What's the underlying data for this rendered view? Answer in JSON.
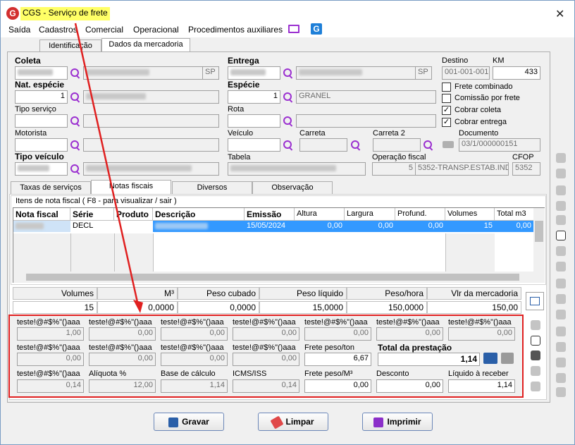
{
  "window": {
    "title": "CGS - Serviço de frete",
    "logo_letter": "G",
    "close_glyph": "✕"
  },
  "menu": {
    "items": [
      "Saída",
      "Cadastros",
      "Comercial",
      "Operacional",
      "Procedimentos auxiliares"
    ],
    "g_icon": "G"
  },
  "tabs_top": {
    "items": [
      "Identificação",
      "Dados da mercadoria"
    ],
    "active": 1
  },
  "form": {
    "coleta": {
      "label": "Coleta",
      "uf": "SP"
    },
    "entrega": {
      "label": "Entrega",
      "uf": "SP"
    },
    "destino": {
      "label": "Destino",
      "value": "001-001-001"
    },
    "km": {
      "label": "KM",
      "value": "433"
    },
    "nat_especie": {
      "label": "Nat. espécie",
      "value": "1"
    },
    "especie": {
      "label": "Espécie",
      "value": "1",
      "desc": "GRANEL"
    },
    "tipo_servico": {
      "label": "Tipo serviço"
    },
    "rota": {
      "label": "Rota"
    },
    "motorista": {
      "label": "Motorista"
    },
    "veiculo": {
      "label": "Veículo"
    },
    "carreta": {
      "label": "Carreta"
    },
    "carreta2": {
      "label": "Carreta 2"
    },
    "documento": {
      "label": "Documento",
      "value": "03/1/000000151"
    },
    "tipo_veiculo": {
      "label": "Tipo veículo"
    },
    "tabela": {
      "label": "Tabela"
    },
    "operacao_fiscal": {
      "label": "Operação fiscal",
      "code": "5",
      "desc": "5352-TRANSP.ESTAB.INDU"
    },
    "cfop": {
      "label": "CFOP",
      "value": "5352"
    },
    "checks": [
      {
        "label": "Frete combinado",
        "checked": false
      },
      {
        "label": "Comissão por frete",
        "checked": false
      },
      {
        "label": "Cobrar coleta",
        "checked": true
      },
      {
        "label": "Cobrar entrega",
        "checked": true
      }
    ]
  },
  "tabs_bottom": {
    "items": [
      "Taxas de serviços",
      "Notas fiscais",
      "Diversos",
      "Observação"
    ],
    "active": 1
  },
  "nf": {
    "group_label": "Itens de nota fiscal ( F8 - para visualizar / sair )",
    "columns": [
      "Nota fiscal",
      "Série",
      "Produto",
      "Descrição",
      "Emissão",
      "Altura",
      "Largura",
      "Profund.",
      "Volumes",
      "Total m3"
    ],
    "row": {
      "serie": "DECL",
      "emissao": "15/05/2024",
      "altura": "0,00",
      "largura": "0,00",
      "profund": "0,00",
      "volumes": "15",
      "total_m3": "0,00"
    }
  },
  "totals": {
    "headers": [
      "Volumes",
      "M³",
      "Peso cubado",
      "Peso líquido",
      "Peso/hora",
      "Vlr da mercadoria"
    ],
    "values": [
      "15",
      "0,0000",
      "0,0000",
      "15,0000",
      "150,0000",
      "150,00"
    ]
  },
  "taxes": {
    "row1": [
      {
        "label": "teste!@#$%\"()aaa",
        "value": "1,00"
      },
      {
        "label": "teste!@#$%\"()aaa",
        "value": "0,00"
      },
      {
        "label": "teste!@#$%\"()aaa",
        "value": "0,00"
      },
      {
        "label": "teste!@#$%\"()aaa",
        "value": "0,00"
      },
      {
        "label": "teste!@#$%\"()aaa",
        "value": "0,00"
      },
      {
        "label": "teste!@#$%\"()aaa",
        "value": "0,00"
      },
      {
        "label": "teste!@#$%\"()aaa",
        "value": "0,00"
      }
    ],
    "row2": [
      {
        "label": "teste!@#$%\"()aaa",
        "value": "0,00"
      },
      {
        "label": "teste!@#$%\"()aaa",
        "value": "0,00"
      },
      {
        "label": "teste!@#$%\"()aaa",
        "value": "0,00"
      },
      {
        "label": "teste!@#$%\"()aaa",
        "value": "0,00"
      },
      {
        "label": "Frete peso/ton",
        "value": "6,67"
      }
    ],
    "total_prestacao": {
      "label": "Total da prestação",
      "value": "1,14"
    },
    "row3": [
      {
        "label": "teste!@#$%\"()aaa",
        "value": "0,14"
      },
      {
        "label": "Alíquota %",
        "value": "12,00"
      },
      {
        "label": "Base de cálculo",
        "value": "1,14"
      },
      {
        "label": "ICMS/ISS",
        "value": "0,14"
      },
      {
        "label": "Frete peso/M³",
        "value": "0,00"
      },
      {
        "label": "Desconto",
        "value": "0,00"
      },
      {
        "label": "Líquido à receber",
        "value": "1,14"
      }
    ]
  },
  "buttons": {
    "gravar": "Gravar",
    "limpar": "Limpar",
    "imprimir": "Imprimir"
  },
  "colors": {
    "accent": "#3399ff",
    "highlight": "#e02020",
    "lookup": "#9b30d0",
    "title_bg": "#ffff66"
  }
}
